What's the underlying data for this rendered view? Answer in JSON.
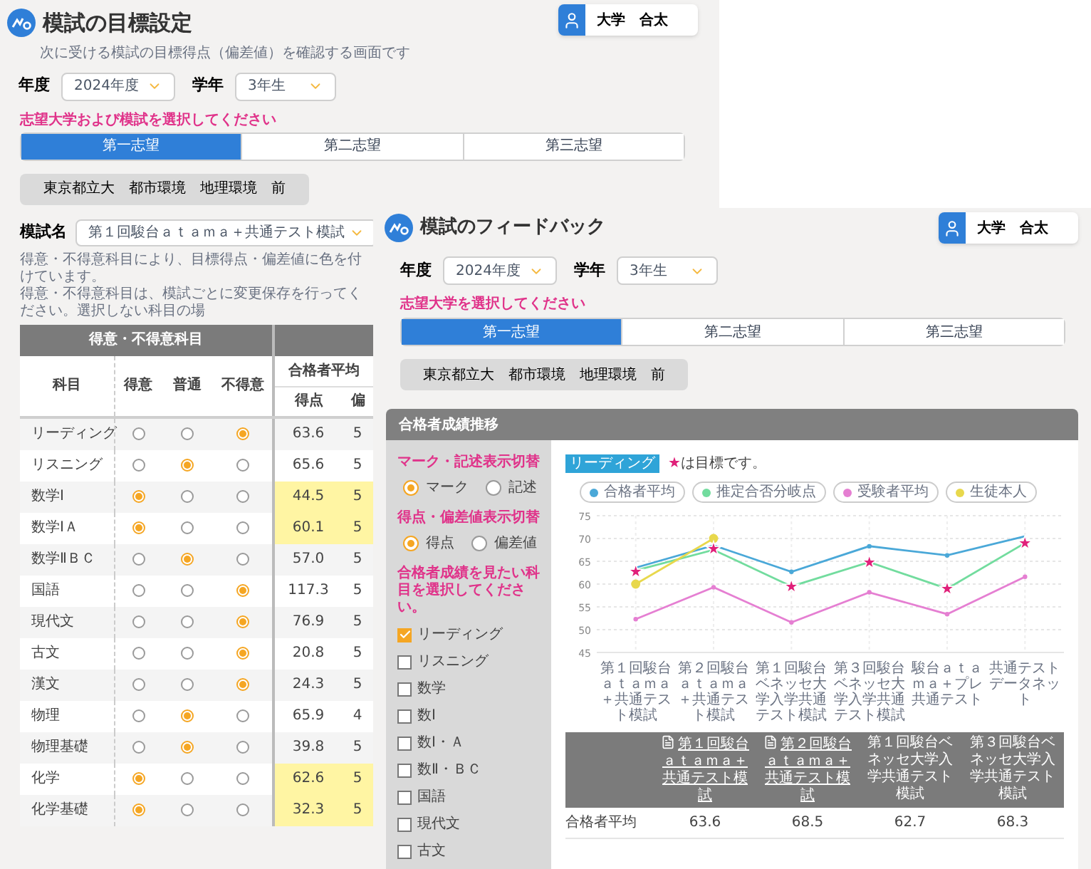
{
  "left_window": {
    "title": "模試の目標設定",
    "subtitle": "次に受ける模試の目標得点（偏差値）を確認する画面です",
    "user": "大学　合太",
    "year": {
      "label": "年度",
      "value": "2024年度"
    },
    "grade": {
      "label": "学年",
      "value": "3年生"
    },
    "prompt": "志望大学および模試を選択してください",
    "tabs": [
      {
        "label": "第一志望",
        "selected": true
      },
      {
        "label": "第二志望",
        "selected": false
      },
      {
        "label": "第三志望",
        "selected": false
      }
    ],
    "university": "東京都立大　都市環境　地理環境　前",
    "exam": {
      "label": "模試名",
      "value": "第１回駿台ａｔａｍａ＋共通テスト模試"
    },
    "notes": [
      "得意・不得意科目により、目標得点・偏差値に色を付けています。",
      "得意・不得意科目は、模試ごとに変更保存を行ってください。選択しない科目の場"
    ],
    "table": {
      "group_header": "得意・不得意科目",
      "columns": [
        "科目",
        "得意",
        "普通",
        "不得意"
      ],
      "score_group": "合格者平均",
      "score_columns": [
        "得点",
        "偏"
      ],
      "rows": [
        {
          "subject": "リーディング",
          "options": [
            {
              "selected": false
            },
            {
              "selected": false
            },
            {
              "selected": true
            }
          ],
          "score": "63.6",
          "column_6": "5"
        },
        {
          "subject": "リスニング",
          "options": [
            {
              "selected": false
            },
            {
              "selected": true
            },
            {
              "selected": false
            }
          ],
          "score": "65.6",
          "column_6": "5"
        },
        {
          "subject": "数学Ⅰ",
          "options": [
            {
              "selected": true
            },
            {
              "selected": false
            },
            {
              "selected": false
            }
          ],
          "score": "44.5",
          "column_6": "5"
        },
        {
          "subject": "数学ⅠＡ",
          "options": [
            {
              "selected": true
            },
            {
              "selected": false
            },
            {
              "selected": false
            }
          ],
          "score": "60.1",
          "column_6": "5"
        },
        {
          "subject": "数学ⅡＢＣ",
          "options": [
            {
              "selected": false
            },
            {
              "selected": true
            },
            {
              "selected": false
            }
          ],
          "score": "57.0",
          "column_6": "5"
        },
        {
          "subject": "国語",
          "options": [
            {
              "selected": false
            },
            {
              "selected": false
            },
            {
              "selected": true
            }
          ],
          "score": "117.3",
          "column_6": "5"
        },
        {
          "subject": "現代文",
          "options": [
            {
              "selected": false
            },
            {
              "selected": false
            },
            {
              "selected": true
            }
          ],
          "score": "76.9",
          "column_6": "5"
        },
        {
          "subject": "古文",
          "options": [
            {
              "selected": false
            },
            {
              "selected": false
            },
            {
              "selected": true
            }
          ],
          "score": "20.8",
          "column_6": "5"
        },
        {
          "subject": "漢文",
          "options": [
            {
              "selected": false
            },
            {
              "selected": false
            },
            {
              "selected": true
            }
          ],
          "score": "24.3",
          "column_6": "5"
        },
        {
          "subject": "物理",
          "options": [
            {
              "selected": false
            },
            {
              "selected": true
            },
            {
              "selected": false
            }
          ],
          "score": "65.9",
          "column_6": "4"
        },
        {
          "subject": "物理基礎",
          "options": [
            {
              "selected": false
            },
            {
              "selected": true
            },
            {
              "selected": false
            }
          ],
          "score": "39.8",
          "column_6": "5"
        },
        {
          "subject": "化学",
          "options": [
            {
              "selected": true
            },
            {
              "selected": false
            },
            {
              "selected": false
            }
          ],
          "score": "62.6",
          "column_6": "5"
        },
        {
          "subject": "化学基礎",
          "options": [
            {
              "selected": true
            },
            {
              "selected": false
            },
            {
              "selected": false
            }
          ],
          "score": "32.3",
          "column_6": "5"
        }
      ]
    }
  },
  "right_window": {
    "title": "模試のフィードバック",
    "user": "大学　合太",
    "year": {
      "label": "年度",
      "value": "2024年度"
    },
    "grade": {
      "label": "学年",
      "value": "3年生"
    },
    "prompt": "志望大学を選択してください",
    "tabs": [
      {
        "label": "第一志望",
        "selected": true
      },
      {
        "label": "第二志望",
        "selected": false
      },
      {
        "label": "第三志望",
        "selected": false
      }
    ],
    "university": "東京都立大　都市環境　地理環境　前",
    "panel": {
      "title": "合格者成績推移",
      "toggles": [
        {
          "title": "マーク・記述表示切替",
          "options": [
            {
              "label": "マーク",
              "selected": true
            },
            {
              "label": "記述",
              "selected": false
            }
          ]
        },
        {
          "title": "得点・偏差値表示切替",
          "options": [
            {
              "label": "得点",
              "selected": true
            },
            {
              "label": "偏差値",
              "selected": false
            }
          ]
        }
      ],
      "subject_prompt": "合格者成績を見たい科目を選択してください。",
      "subjects": [
        {
          "label": "リーディング",
          "checked": true
        },
        {
          "label": "リスニング",
          "checked": false
        },
        {
          "label": "数学",
          "checked": false
        },
        {
          "label": "数Ⅰ",
          "checked": false
        },
        {
          "label": "数Ⅰ・Ａ",
          "checked": false
        },
        {
          "label": "数Ⅱ・ＢＣ",
          "checked": false
        },
        {
          "label": "国語",
          "checked": false
        },
        {
          "label": "現代文",
          "checked": false
        },
        {
          "label": "古文",
          "checked": false
        }
      ],
      "subject_tag": "リーディング",
      "target_note": {
        "mark": "★",
        "text": "は目標です。"
      },
      "chart_data": {
        "type": "line",
        "grid": true,
        "categories": [
          "第１回駿台ａｔａｍａ＋共通テスト模試",
          "第２回駿台ａｔａｍａ＋共通テスト模試",
          "第１回駿台ベネッセ大学入学共通テスト模試",
          "第３回駿台ベネッセ大学入学共通テスト模試",
          "駿台ａｔａｍａ＋プレ共通テスト",
          "共通テストデータネット"
        ],
        "series": [
          {
            "name": "合格者平均",
            "color": "#4aa8d8",
            "marker": "circle",
            "values": [
              63.6,
              68.5,
              62.7,
              68.3,
              66.3,
              70.5
            ]
          },
          {
            "name": "推定合否分岐点",
            "color": "#72dc9e",
            "marker": "none",
            "values": [
              63.0,
              67.5,
              59.5,
              64.8,
              59.0,
              69.0
            ]
          },
          {
            "name": "受験者平均",
            "color": "#e57fd2",
            "marker": "circle",
            "values": [
              52.3,
              59.3,
              51.6,
              58.2,
              53.4,
              61.6
            ]
          },
          {
            "name": "生徒本人",
            "color": "#e8d84c",
            "marker": "circle",
            "values": [
              60.0,
              70.0,
              null,
              null,
              null,
              null
            ]
          }
        ],
        "ylim": [
          45,
          75
        ],
        "yticks": [
          45,
          50,
          55,
          60,
          65,
          70,
          75
        ],
        "annotations": [
          {
            "x": "第１回駿台ａｔａｍａ＋共通テスト模試",
            "y": 62.8,
            "text": "★"
          },
          {
            "x": "第２回駿台ａｔａｍａ＋共通テスト模試",
            "y": 67.8,
            "text": "★"
          },
          {
            "x": "第１回駿台ベネッセ大学入学共通テスト模試",
            "y": 59.5,
            "text": "★"
          },
          {
            "x": "第３回駿台ベネッセ大学入学共通テスト模試",
            "y": 64.8,
            "text": "★"
          },
          {
            "x": "駿台ａｔａｍａ＋プレ共通テスト",
            "y": 59.0,
            "text": "★"
          },
          {
            "x": "共通テストデータネット",
            "y": 69.0,
            "text": "★"
          }
        ]
      },
      "table": {
        "columns": [
          {
            "kind": "link",
            "label": "第１回駿台ａｔａｍａ＋共通テスト模試"
          },
          {
            "kind": "link",
            "label": "第２回駿台ａｔａｍａ＋共通テスト模試"
          },
          {
            "kind": "text",
            "label": "第１回駿台ベネッセ大学入学共通テスト模試"
          },
          {
            "kind": "text",
            "label": "第３回駿台ベネッセ大学入学共通テスト模試"
          }
        ],
        "rows": [
          {
            "label": "合格者平均",
            "values": [
              "63.6",
              "68.5",
              "62.7",
              "68.3"
            ]
          }
        ]
      }
    }
  }
}
